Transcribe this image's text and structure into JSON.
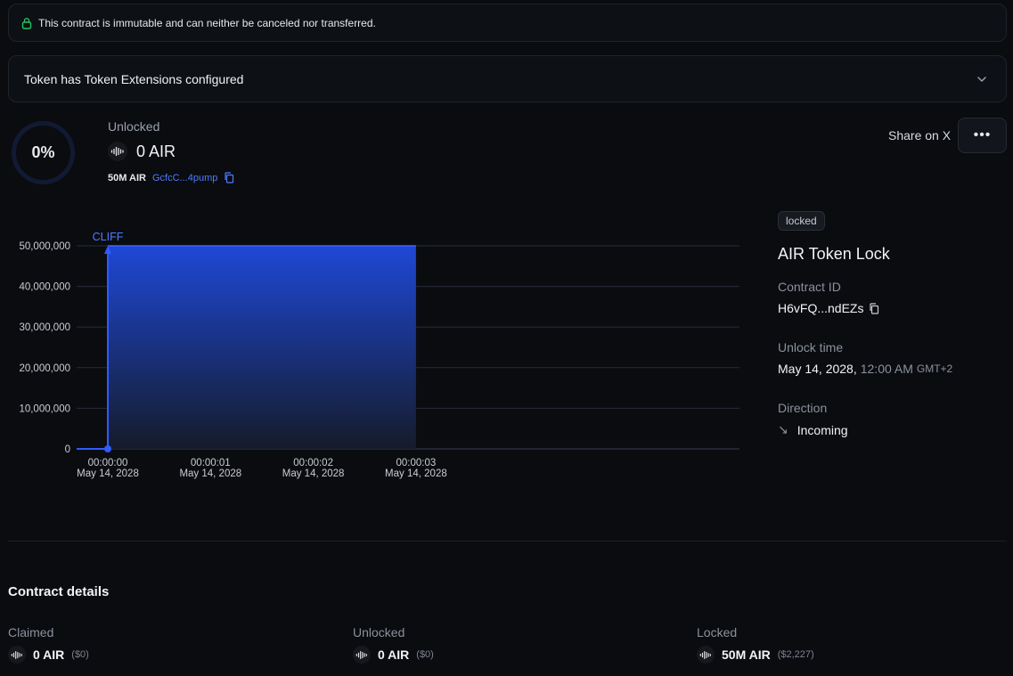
{
  "notice": {
    "text": "This contract is immutable and can neither be canceled nor transferred.",
    "icon": "lock-icon",
    "accent": "#22c55e"
  },
  "extensions": {
    "label": "Token has Token Extensions configured",
    "icon": "chevron-down-icon"
  },
  "progress": {
    "percent_label": "0%",
    "fraction": 0
  },
  "unlocked_summary": {
    "title": "Unlocked",
    "amount": "0 AIR",
    "total": "50M AIR",
    "mint_address": "GcfcC...4pump"
  },
  "actions": {
    "share_label": "Share on X",
    "more_label": "•••"
  },
  "chart_data": {
    "type": "area",
    "annotation": "CLIFF",
    "y_ticks": [
      "50,000,000",
      "40,000,000",
      "30,000,000",
      "20,000,000",
      "10,000,000",
      "0"
    ],
    "ylim": [
      0,
      50000000
    ],
    "x_ticks": [
      {
        "time": "00:00:00",
        "date": "May 14, 2028"
      },
      {
        "time": "00:00:01",
        "date": "May 14, 2028"
      },
      {
        "time": "00:00:02",
        "date": "May 14, 2028"
      },
      {
        "time": "00:00:03",
        "date": "May 14, 2028"
      }
    ],
    "series": [
      {
        "points": [
          [
            "00:00:00",
            0
          ],
          [
            "00:00:00",
            50000000
          ],
          [
            "00:00:03",
            50000000
          ]
        ]
      }
    ],
    "color": "#2f5bff",
    "grid": true
  },
  "contract": {
    "status_badge": "locked",
    "title": "AIR Token Lock",
    "id_label": "Contract ID",
    "id_value": "H6vFQ...ndEZs",
    "unlock_label": "Unlock time",
    "unlock_date": "May 14, 2028,",
    "unlock_time": "12:00 AM",
    "unlock_tz": "GMT+2",
    "direction_label": "Direction",
    "direction_arrow": "↘",
    "direction_value": "Incoming"
  },
  "details": {
    "title": "Contract details",
    "items": [
      {
        "label": "Claimed",
        "amount": "0 AIR",
        "usd": "($0)"
      },
      {
        "label": "Unlocked",
        "amount": "0 AIR",
        "usd": "($0)"
      },
      {
        "label": "Locked",
        "amount": "50M AIR",
        "usd": "($2,227)"
      }
    ]
  }
}
